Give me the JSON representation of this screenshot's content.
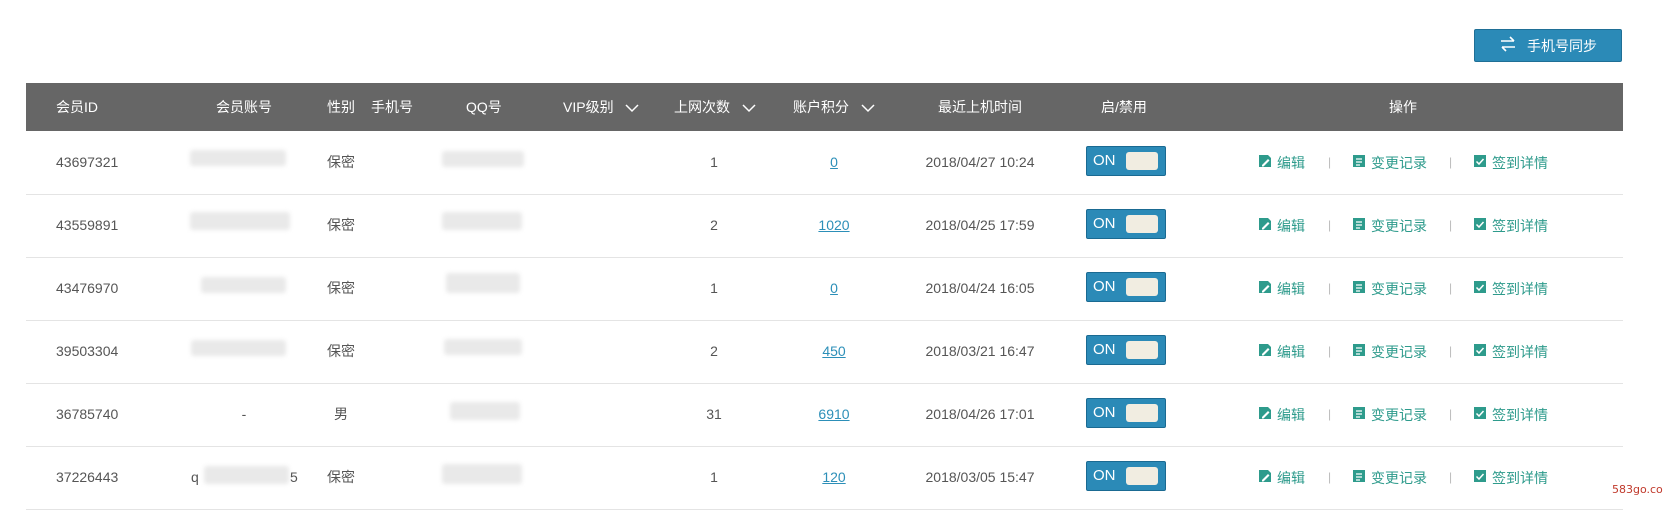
{
  "toolbar": {
    "sync_label": "手机号同步",
    "sync_icon": "swap-arrows-icon"
  },
  "table": {
    "headers": {
      "member_id": "会员ID",
      "account": "会员账号",
      "gender": "性别",
      "phone": "手机号",
      "qq": "QQ号",
      "vip": "VIP级别",
      "logins": "上网次数",
      "points": "账户积分",
      "last_time": "最近上机时间",
      "enable": "启/禁用",
      "ops": "操作"
    },
    "rows": [
      {
        "id": "43697321",
        "account": "",
        "gender": "保密",
        "logins": "1",
        "points": "0",
        "last": "2018/04/27 10:24",
        "toggle": "ON"
      },
      {
        "id": "43559891",
        "account": "",
        "gender": "保密",
        "logins": "2",
        "points": "1020",
        "last": "2018/04/25 17:59",
        "toggle": "ON"
      },
      {
        "id": "43476970",
        "account": "",
        "gender": "保密",
        "logins": "1",
        "points": "0",
        "last": "2018/04/24 16:05",
        "toggle": "ON"
      },
      {
        "id": "39503304",
        "account": "",
        "gender": "保密",
        "logins": "2",
        "points": "450",
        "last": "2018/03/21 16:47",
        "toggle": "ON"
      },
      {
        "id": "36785740",
        "account": "-",
        "gender": "男",
        "logins": "31",
        "points": "6910",
        "last": "2018/04/26 17:01",
        "toggle": "ON"
      },
      {
        "id": "37226443",
        "account": "q",
        "account_suffix": "5",
        "gender": "保密",
        "logins": "1",
        "points": "120",
        "last": "2018/03/05 15:47",
        "toggle": "ON"
      }
    ],
    "actions": {
      "edit": "编辑",
      "history": "变更记录",
      "checkin": "签到详情",
      "separator": "|"
    }
  },
  "colors": {
    "header_bg": "#666666",
    "accent": "#2b8ab7",
    "action_green": "#2e9b8c",
    "link": "#2c8fb8"
  },
  "watermark": "583go.com"
}
